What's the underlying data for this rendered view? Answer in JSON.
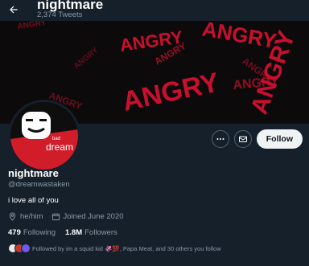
{
  "header": {
    "title": "nightmare",
    "tweet_count": "2,374 Tweets"
  },
  "banner": {
    "words": [
      "ANGRY",
      "ANGRY",
      "ANGRY",
      "ANGRY",
      "ANGRY",
      "ANGRY",
      "ANGRY",
      "ANGRY",
      "ANGRY",
      "ANGRY"
    ],
    "bg_color": "#0c0a0b",
    "word_color": "#c8102e"
  },
  "avatar": {
    "text_bad": "bad",
    "text_brand": "dream"
  },
  "actions": {
    "more_icon": "more-icon",
    "message_icon": "envelope-icon",
    "follow_label": "Follow"
  },
  "profile": {
    "name": "nightmare",
    "handle": "@dreamwastaken",
    "bio": "i love all of you",
    "pronouns": "he/him",
    "joined": "Joined June 2020"
  },
  "stats": {
    "following_num": "479",
    "following_label": "Following",
    "followers_num": "1.8M",
    "followers_label": "Followers"
  },
  "followed_by": {
    "text": "Followed by im a squid kid 🦑💯, Papa Meat, and 30 others you follow"
  },
  "colors": {
    "background": "#15202b",
    "muted": "#8b98a5",
    "accent_red": "#c8102e"
  }
}
